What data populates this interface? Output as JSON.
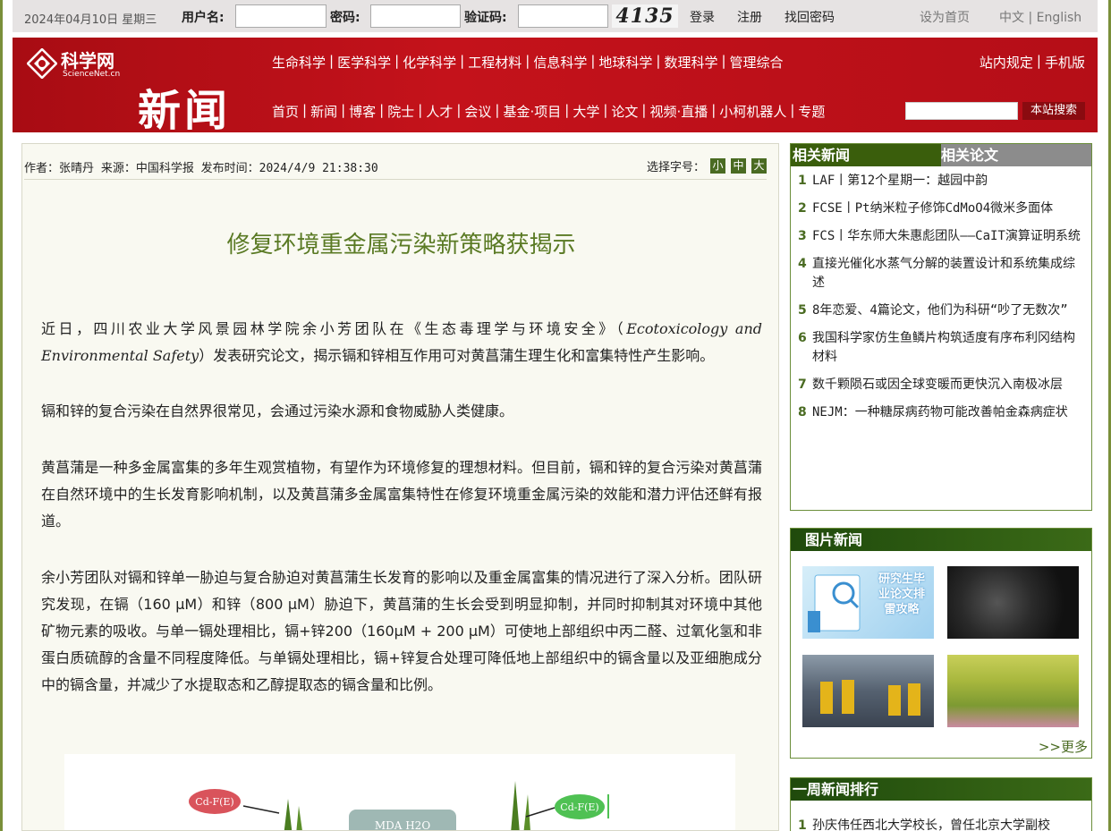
{
  "topbar": {
    "date": "2024年04月10日 星期三",
    "username_label": "用户名:",
    "password_label": "密码:",
    "captcha_label": "验证码:",
    "captcha_text": "4135",
    "login": "登录",
    "register": "注册",
    "recover": "找回密码",
    "set_home": "设为首页",
    "lang": "中文 | English"
  },
  "header": {
    "logo_name": "科学网",
    "logo_sub": "ScienceNet.cn",
    "section_title": "新闻",
    "nav_primary": [
      "生命科学",
      "医学科学",
      "化学科学",
      "工程材料",
      "信息科学",
      "地球科学",
      "数理科学",
      "管理综合"
    ],
    "nav_secondary": [
      "首页",
      "新闻",
      "博客",
      "院士",
      "人才",
      "会议",
      "基金·项目",
      "大学",
      "论文",
      "视频·直播",
      "小柯机器人",
      "专题"
    ],
    "right_links": [
      "站内规定",
      "手机版"
    ],
    "search_button": "本站搜索"
  },
  "article": {
    "meta": "作者：张晴丹 来源：中国科学报 发布时间：2024/4/9 21:38:30",
    "font_size_label": "选择字号：",
    "font_sizes": [
      "小",
      "中",
      "大"
    ],
    "title": "修复环境重金属污染新策略获揭示",
    "p1_a": "近日，四川农业大学风景园林学院余小芳团队在《生态毒理学与环境安全》（",
    "p1_i": "Ecotoxicology and Environmental Safety",
    "p1_b": "）发表研究论文，揭示镉和锌相互作用可对黄菖蒲生理生化和富集特性产生影响。",
    "p2": "镉和锌的复合污染在自然界很常见，会通过污染水源和食物威胁人类健康。",
    "p3": "黄菖蒲是一种多金属富集的多年生观赏植物，有望作为环境修复的理想材料。但目前，镉和锌的复合污染对黄菖蒲在自然环境中的生长发育影响机制，以及黄菖蒲多金属富集特性在修复环境重金属污染的效能和潜力评估还鲜有报道。",
    "p4": "余小芳团队对镉和锌单一胁迫与复合胁迫对黄菖蒲生长发育的影响以及重金属富集的情况进行了深入分析。团队研究发现，在镉（160 μM）和锌（800 μM）胁迫下，黄菖蒲的生长会受到明显抑制，并同时抑制其对环境中其他矿物元素的吸收。与单一镉处理相比，镉+锌200（160μM + 200 μM）可使地上部组织中丙二醛、过氧化氢和非蛋白质硫醇的含量不同程度降低。与单镉处理相比，镉+锌复合处理可降低地上部组织中的镉含量以及亚细胞成分中的镉含量，并减少了水提取态和乙醇提取态的镉含量和比例。",
    "figure_labels": [
      "Cd-F(E)",
      "MDA H2O",
      "Cd-F(E)"
    ]
  },
  "related": {
    "tab_news": "相关新闻",
    "tab_papers": "相关论文",
    "items": [
      {
        "num": "1",
        "text": "LAF丨第12个星期一：越园中韵"
      },
      {
        "num": "2",
        "text": "FCSE丨Pt纳米粒子修饰CdMoO4微米多面体"
      },
      {
        "num": "3",
        "text": "FCS丨华东师大朱惠彪团队——CaIT演算证明系统"
      },
      {
        "num": "4",
        "text": "直接光催化水蒸气分解的装置设计和系统集成综述"
      },
      {
        "num": "5",
        "text": "8年恋爱、4篇论文，他们为科研“吵了无数次”"
      },
      {
        "num": "6",
        "text": "我国科学家仿生鱼鳞片构筑适度有序布利冈结构材料"
      },
      {
        "num": "7",
        "text": "数千颗陨石或因全球变暖而更快沉入南极冰层"
      },
      {
        "num": "8",
        "text": "NEJM：一种糖尿病药物可能改善帕金森病症状"
      }
    ]
  },
  "photo_news": {
    "title": "图片新闻",
    "pic1_text": "研究生毕业论文排雷攻略",
    "more": ">>更多"
  },
  "weekly": {
    "title": "一周新闻排行",
    "first": {
      "num": "1",
      "text": "孙庆伟任西北大学校长，曾任北京大学副校"
    }
  },
  "colors": {
    "brand_red": "#b50e17",
    "accent_green": "#3a5e0c",
    "title_green": "#5a7a24"
  }
}
